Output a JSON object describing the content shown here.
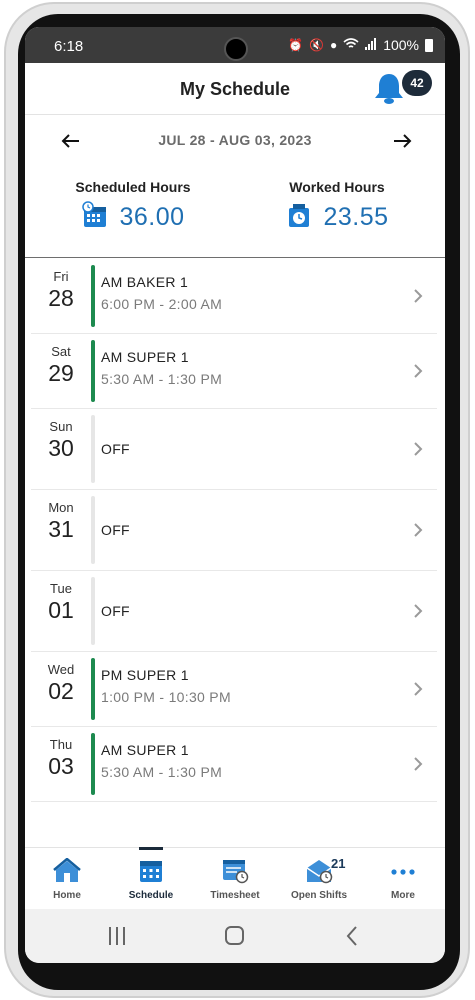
{
  "status_bar": {
    "time": "6:18",
    "battery": "100%"
  },
  "header": {
    "title": "My Schedule",
    "notification_count": "42"
  },
  "week": {
    "range": "JUL 28 - AUG 03, 2023"
  },
  "summary": {
    "scheduled_label": "Scheduled Hours",
    "scheduled_value": "36.00",
    "worked_label": "Worked Hours",
    "worked_value": "23.55"
  },
  "schedule": [
    {
      "dow": "Fri",
      "date": "28",
      "shift": "AM BAKER 1",
      "hours": "6:00 PM - 2:00 AM",
      "off": false
    },
    {
      "dow": "Sat",
      "date": "29",
      "shift": "AM SUPER 1",
      "hours": "5:30 AM - 1:30 PM",
      "off": false
    },
    {
      "dow": "Sun",
      "date": "30",
      "shift": "OFF",
      "hours": "",
      "off": true
    },
    {
      "dow": "Mon",
      "date": "31",
      "shift": "OFF",
      "hours": "",
      "off": true
    },
    {
      "dow": "Tue",
      "date": "01",
      "shift": "OFF",
      "hours": "",
      "off": true
    },
    {
      "dow": "Wed",
      "date": "02",
      "shift": "PM SUPER 1",
      "hours": "1:00 PM - 10:30 PM",
      "off": false
    },
    {
      "dow": "Thu",
      "date": "03",
      "shift": "AM SUPER 1",
      "hours": "5:30 AM - 1:30 PM",
      "off": false
    }
  ],
  "bottom_nav": {
    "items": [
      {
        "label": "Home",
        "icon": "home-icon"
      },
      {
        "label": "Schedule",
        "icon": "calendar-icon",
        "active": true
      },
      {
        "label": "Timesheet",
        "icon": "timesheet-icon"
      },
      {
        "label": "Open Shifts",
        "icon": "open-shifts-icon",
        "badge": "21"
      },
      {
        "label": "More",
        "icon": "more-dots-icon"
      }
    ]
  },
  "colors": {
    "accent_blue": "#1f6fb2",
    "shift_green": "#1d8a4f",
    "nav_dark": "#1b2a3a"
  }
}
